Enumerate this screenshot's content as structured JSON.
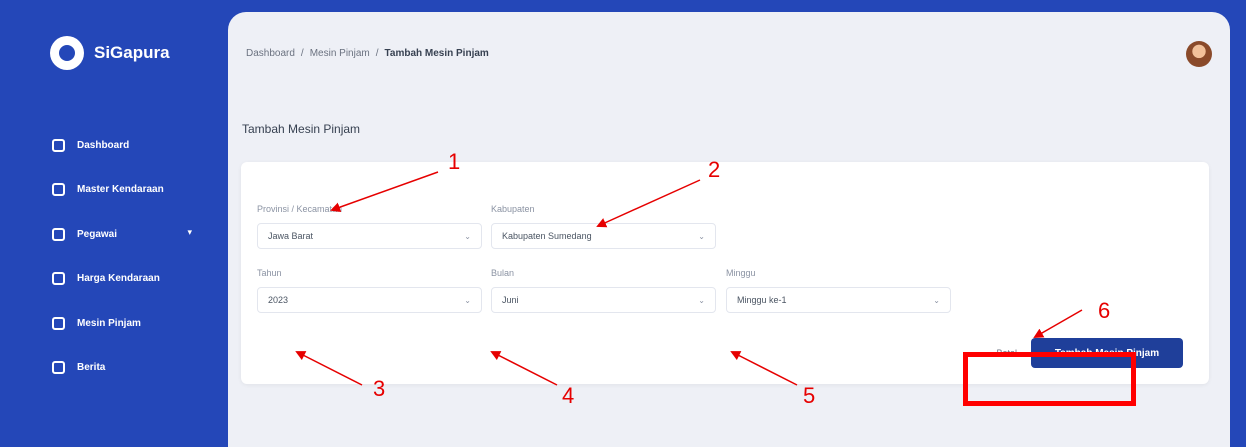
{
  "sidebar": {
    "brand": "SiGapura",
    "items": [
      {
        "label": "Dashboard",
        "icon": "grid-icon"
      },
      {
        "label": "Master Kendaraan",
        "icon": "document-icon"
      },
      {
        "label": "Pegawai",
        "icon": "users-icon",
        "has_caret": true
      },
      {
        "label": "Harga Kendaraan",
        "icon": "tag-icon"
      },
      {
        "label": "Mesin Pinjam",
        "icon": "shield-icon"
      },
      {
        "label": "Berita",
        "icon": "list-icon"
      }
    ]
  },
  "header": {
    "breadcrumb": [
      "Dashboard",
      "Mesin Pinjam",
      "Tambah Mesin Pinjam"
    ],
    "separator": "/"
  },
  "page": {
    "title": "Tambah Mesin Pinjam"
  },
  "form": {
    "fields": [
      {
        "label": "Provinsi / Kecamatan",
        "value": "Jawa Barat"
      },
      {
        "label": "Kabupaten",
        "value": "Kabupaten Sumedang"
      },
      {
        "label": "Tahun",
        "value": "2023"
      },
      {
        "label": "Bulan",
        "value": "Juni"
      },
      {
        "label": "Minggu",
        "value": "Minggu ke-1"
      }
    ],
    "cancel_label": "Batal",
    "submit_label": "Tambah Mesin Pinjam"
  },
  "annotations": {
    "numbers": [
      "1",
      "2",
      "3",
      "4",
      "5",
      "6"
    ],
    "color": "#ff0000"
  },
  "colors": {
    "sidebar_bg": "#2447b8",
    "primary_button": "#1f3f9a",
    "annotation": "#ff0000"
  }
}
